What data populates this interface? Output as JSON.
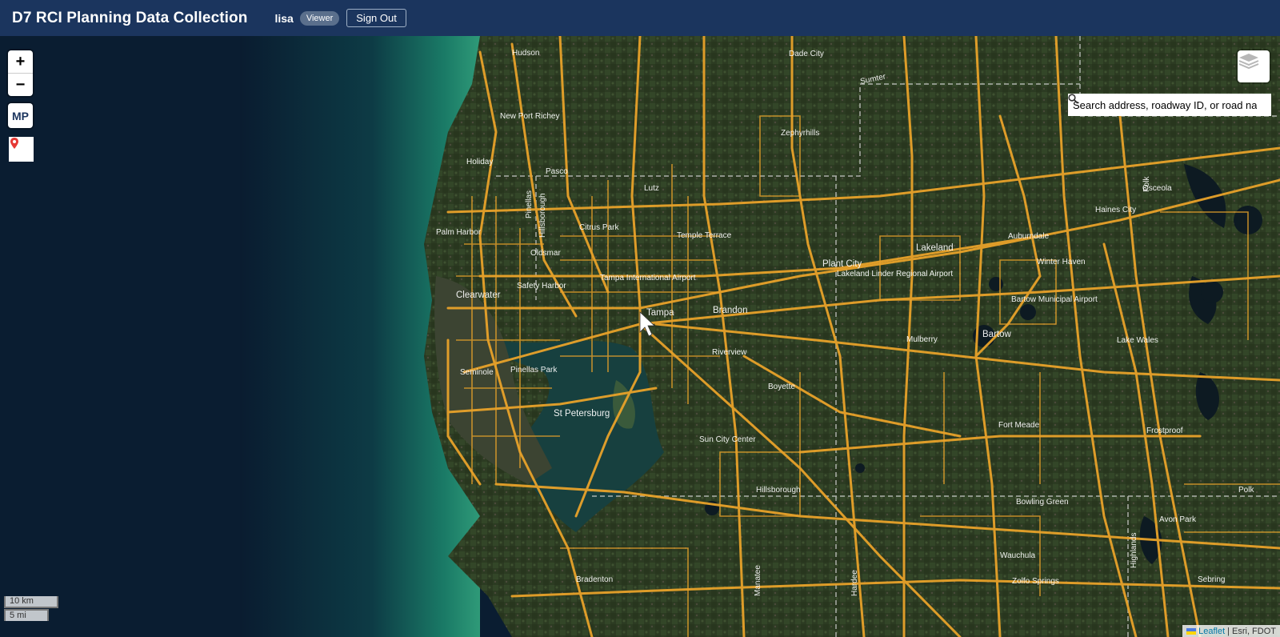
{
  "header": {
    "title": "D7 RCI Planning Data Collection",
    "username": "lisa",
    "role": "Viewer",
    "sign_out_label": "Sign Out"
  },
  "map_controls": {
    "zoom_in": "+",
    "zoom_out": "−",
    "mp_label": "MP",
    "pin_icon": "map-pin-icon",
    "layers_icon": "layers-icon"
  },
  "search": {
    "placeholder": "Search address, roadway ID, or road name..."
  },
  "scale": {
    "km": "10 km",
    "mi": "5 mi"
  },
  "attribution": {
    "leaflet": "Leaflet",
    "providers": "Esri, FDOT"
  },
  "places": [
    "Hudson",
    "Dade City",
    "Sumter",
    "New Port Richey",
    "Holiday",
    "Pasco",
    "Zephyrhills",
    "Lutz",
    "Pinellas",
    "Hillsborough",
    "Palm Harbor",
    "Citrus Park",
    "Temple Terrace",
    "Oldsmar",
    "Tampa International Airport",
    "Safety Harbor",
    "Clearwater",
    "Tampa",
    "Brandon",
    "Plant City",
    "Lakeland Linder Regional Airport",
    "Lakeland",
    "Auburndale",
    "Winter Haven",
    "Haines City",
    "Osceola",
    "Polk",
    "Bartow Municipal Airport",
    "Bartow",
    "Mulberry",
    "Riverview",
    "Lake Wales",
    "Seminole",
    "Pinellas Park",
    "Boyette",
    "St Petersburg",
    "Sun City Center",
    "Fort Meade",
    "Frostproof",
    "Hillsborough",
    "Bowling Green",
    "Polk",
    "Avon Park",
    "Bradenton",
    "Wauchula",
    "Zolfo Springs",
    "Sebring",
    "Highlands",
    "Manatee",
    "Hardee"
  ]
}
